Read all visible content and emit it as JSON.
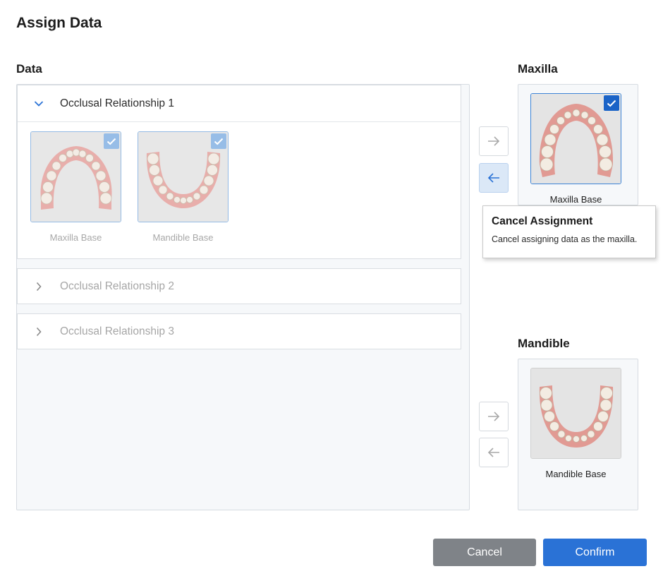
{
  "dialog": {
    "title": "Assign Data"
  },
  "data_section": {
    "label": "Data",
    "groups": [
      {
        "name": "Occlusal Relationship 1",
        "expanded": true,
        "items": [
          {
            "label": "Maxilla Base",
            "checked": true
          },
          {
            "label": "Mandible Base",
            "checked": true
          }
        ]
      },
      {
        "name": "Occlusal Relationship 2",
        "expanded": false
      },
      {
        "name": "Occlusal Relationship 3",
        "expanded": false
      }
    ]
  },
  "maxilla": {
    "label": "Maxilla",
    "item": {
      "label": "Maxilla Base",
      "checked": true
    }
  },
  "mandible": {
    "label": "Mandible",
    "item": {
      "label": "Mandible Base"
    }
  },
  "tooltip": {
    "title": "Cancel Assignment",
    "body": "Cancel assigning data as the maxilla."
  },
  "buttons": {
    "cancel": "Cancel",
    "confirm": "Confirm"
  },
  "colors": {
    "accent": "#2a72d6",
    "check_solid": "#1a63c7",
    "check_light": "#8fb8e6",
    "cancel_bg": "#7f8388"
  },
  "icons": [
    "chevron-down-icon",
    "chevron-right-icon",
    "arrow-right-icon",
    "arrow-left-icon",
    "checkmark-icon"
  ]
}
